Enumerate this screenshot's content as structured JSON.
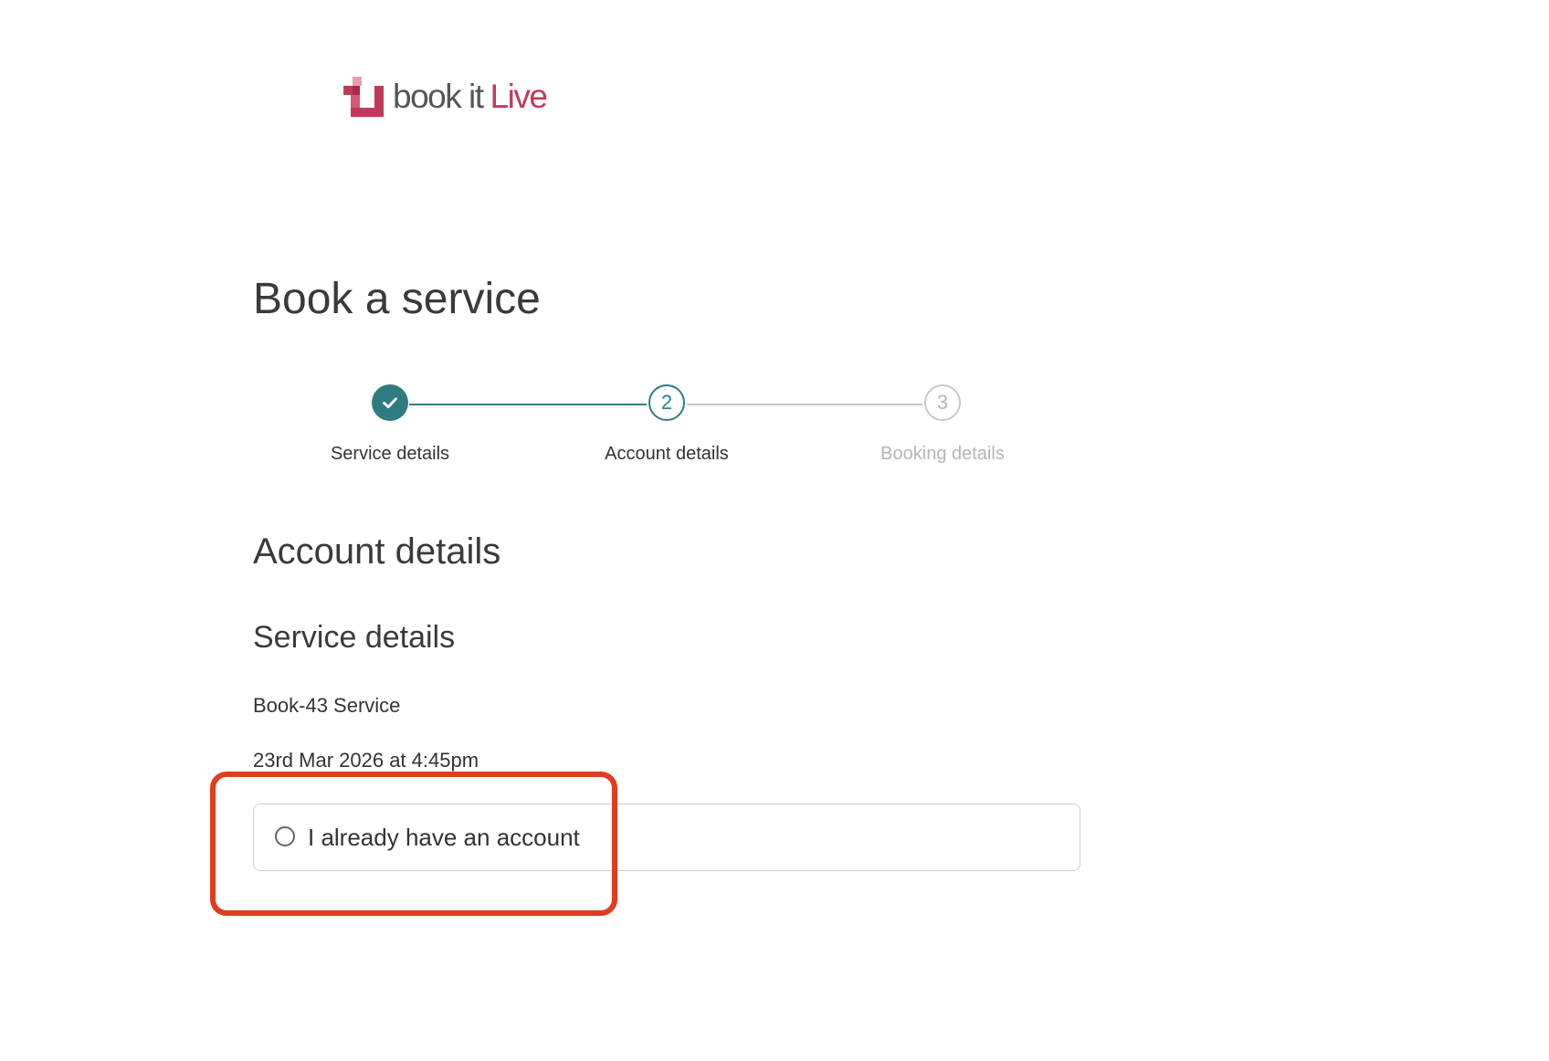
{
  "brand": {
    "logo_text_primary": "book it",
    "logo_text_accent": "Live",
    "accent_color": "#c23a5a",
    "logo_icon": "bookitlive-logo-icon"
  },
  "page": {
    "title": "Book a service"
  },
  "stepper": {
    "active_color": "#2f7b82",
    "inactive_color": "#c9c9c9",
    "steps": [
      {
        "label": "Service details",
        "number": "1",
        "status": "completed",
        "icon": "check-icon"
      },
      {
        "label": "Account details",
        "number": "2",
        "status": "current"
      },
      {
        "label": "Booking details",
        "number": "3",
        "status": "upcoming"
      }
    ]
  },
  "main": {
    "section_title": "Account details",
    "subsection_title": "Service details",
    "service_name": "Book-43 Service",
    "service_datetime": "23rd Mar 2026 at 4:45pm",
    "account_option": {
      "label": "I already have an account",
      "selected": false
    }
  },
  "annotation": {
    "highlight_color": "#e03c1e"
  }
}
